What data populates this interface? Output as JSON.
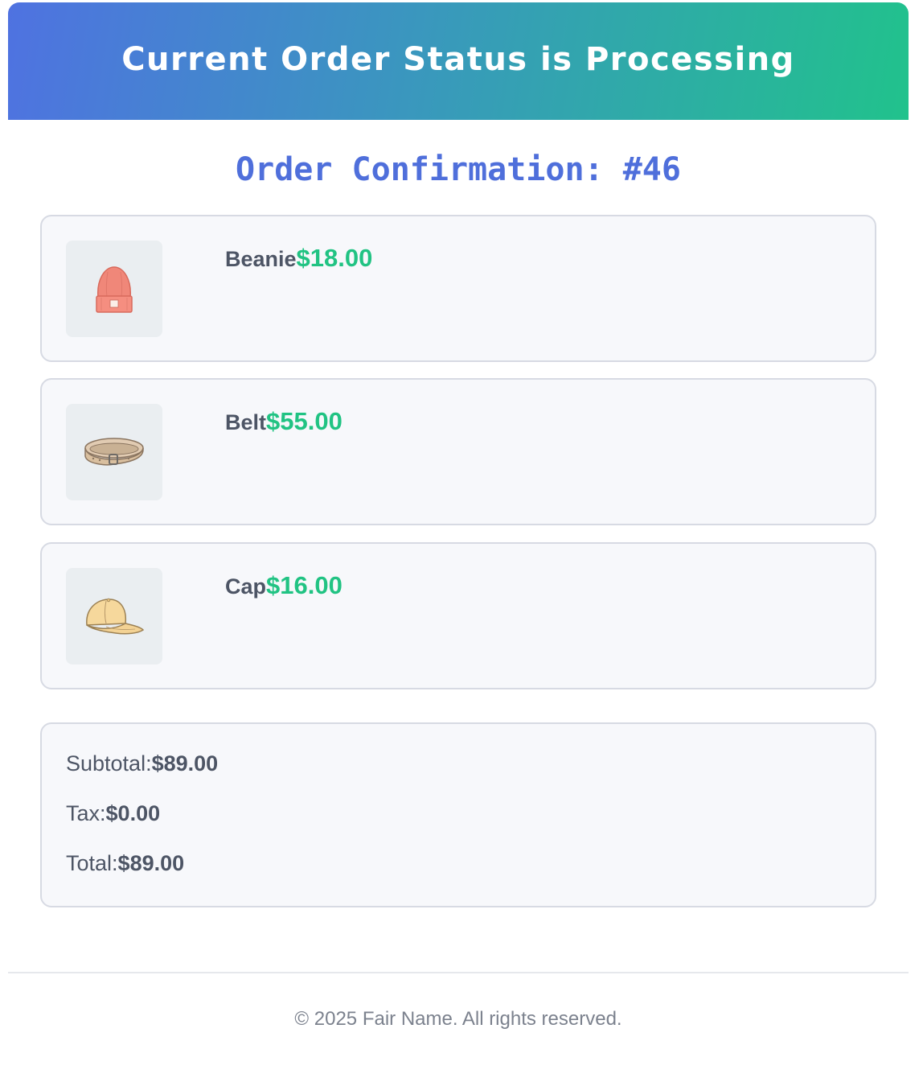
{
  "banner": {
    "title": "Current Order Status is Processing"
  },
  "order": {
    "title": "Order Confirmation: #46"
  },
  "items": [
    {
      "name": "Beanie",
      "price": "$18.00",
      "icon": "beanie-icon"
    },
    {
      "name": "Belt",
      "price": "$55.00",
      "icon": "belt-icon"
    },
    {
      "name": "Cap",
      "price": "$16.00",
      "icon": "cap-icon"
    }
  ],
  "summary": {
    "subtotal_label": "Subtotal:",
    "subtotal_value": "$89.00",
    "tax_label": "Tax:",
    "tax_value": "$0.00",
    "total_label": "Total:",
    "total_value": "$89.00"
  },
  "footer": {
    "text": "© 2025 Fair Name. All rights reserved."
  },
  "colors": {
    "gradient_start": "#4f72e1",
    "gradient_end": "#21c28c",
    "title_blue": "#4f6fdb",
    "price_green": "#21c383"
  }
}
